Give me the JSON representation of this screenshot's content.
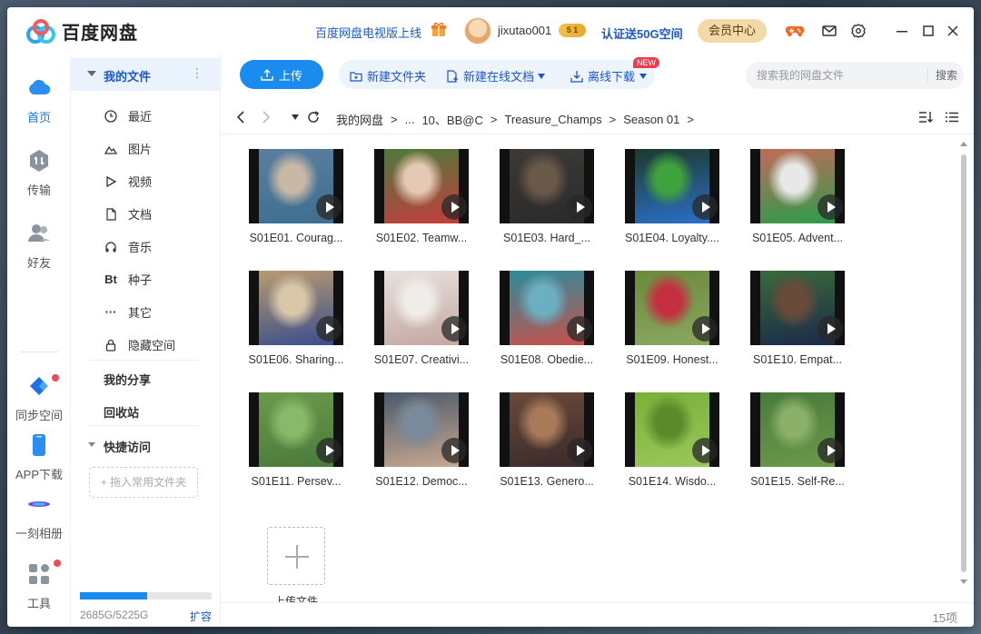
{
  "app": {
    "name": "百度网盘"
  },
  "header": {
    "tv_link": "百度网盘电视版上线",
    "username": "jixutao001",
    "vip_badge": "5 1",
    "promo_link": "认证送50G空间",
    "member_center": "会员中心"
  },
  "leftnav": {
    "items": [
      {
        "label": "首页",
        "icon": "cloud-icon",
        "active": true
      },
      {
        "label": "传输",
        "icon": "transfer-icon"
      },
      {
        "label": "好友",
        "icon": "friends-icon"
      },
      {
        "label": "同步空间",
        "icon": "sync-icon",
        "dot": true
      },
      {
        "label": "APP下载",
        "icon": "phone-icon"
      },
      {
        "label": "一刻相册",
        "icon": "album-icon"
      },
      {
        "label": "工具",
        "icon": "tools-icon",
        "dot": true
      }
    ]
  },
  "sidebar": {
    "my_files": "我的文件",
    "items": [
      {
        "label": "最近",
        "icon": "clock-icon"
      },
      {
        "label": "图片",
        "icon": "image-icon"
      },
      {
        "label": "视频",
        "icon": "play-icon"
      },
      {
        "label": "文档",
        "icon": "document-icon"
      },
      {
        "label": "音乐",
        "icon": "headphones-icon"
      },
      {
        "label": "种子",
        "icon": "torrent-icon",
        "glyph": "Bt"
      },
      {
        "label": "其它",
        "icon": "more-icon",
        "glyph": "···"
      },
      {
        "label": "隐藏空间",
        "icon": "lock-icon"
      }
    ],
    "my_share": "我的分享",
    "recycle_bin": "回收站",
    "quick_access": "快捷访问",
    "drag_hint": "+ 拖入常用文件夹",
    "storage": {
      "used_fraction": 0.51,
      "text": "2685G/5225G",
      "expand": "扩容"
    }
  },
  "toolbar": {
    "upload": "上传",
    "new_folder": "新建文件夹",
    "new_online_doc": "新建在线文档",
    "new_badge": "NEW",
    "offline_download": "离线下载",
    "search_placeholder": "搜索我的网盘文件",
    "search_button": "搜索"
  },
  "breadcrumb": [
    "我的网盘",
    "...",
    "10、BB@C",
    "Treasure_Champs",
    "Season 01"
  ],
  "files": [
    {
      "name": "S01E01. Courag...",
      "colors": [
        "#5a7fa0",
        "#c9b8a6",
        "#3d6e8f"
      ]
    },
    {
      "name": "S01E02. Teamw...",
      "colors": [
        "#4c7a3a",
        "#e6c9b4",
        "#c43d3d"
      ]
    },
    {
      "name": "S01E03. Hard_...",
      "colors": [
        "#3d3a36",
        "#6b5a4a",
        "#2a2a2a"
      ]
    },
    {
      "name": "S01E04. Loyalty....",
      "colors": [
        "#1d3a2a",
        "#3fa33d",
        "#2b6fc9"
      ]
    },
    {
      "name": "S01E05. Advent...",
      "colors": [
        "#c26b5a",
        "#e8e8e8",
        "#2b9c4a"
      ]
    },
    {
      "name": "S01E06. Sharing...",
      "colors": [
        "#b89a70",
        "#d9c8a8",
        "#3a4e8c"
      ]
    },
    {
      "name": "S01E07. Creativi...",
      "colors": [
        "#e8e0dc",
        "#f0ece8",
        "#c4a8a0"
      ]
    },
    {
      "name": "S01E08. Obedie...",
      "colors": [
        "#2c8c9c",
        "#6bb0c0",
        "#c8504a"
      ]
    },
    {
      "name": "S01E09. Honest...",
      "colors": [
        "#6a8a3c",
        "#c43040",
        "#8aa860"
      ]
    },
    {
      "name": "S01E10. Empat...",
      "colors": [
        "#3a6a3a",
        "#6a4a3a",
        "#1a2a4a"
      ]
    },
    {
      "name": "S01E11. Persev...",
      "colors": [
        "#6a9a4a",
        "#8ab86a",
        "#4a7a3a"
      ]
    },
    {
      "name": "S01E12. Democ...",
      "colors": [
        "#4a5a6a",
        "#7a8a9a",
        "#c8a890"
      ]
    },
    {
      "name": "S01E13. Genero...",
      "colors": [
        "#6a4a3a",
        "#a87a5a",
        "#3a2a2a"
      ]
    },
    {
      "name": "S01E14. Wisdo...",
      "colors": [
        "#7ab03a",
        "#5a8a2a",
        "#9ac85a"
      ]
    },
    {
      "name": "S01E15. Self-Re...",
      "colors": [
        "#4a7a3a",
        "#8ab06a",
        "#6a9a4a"
      ]
    }
  ],
  "upload_tile_label": "上传文件",
  "item_count": "15项",
  "colors": {
    "accent": "#1a8cf0",
    "link": "#1a58c9"
  }
}
